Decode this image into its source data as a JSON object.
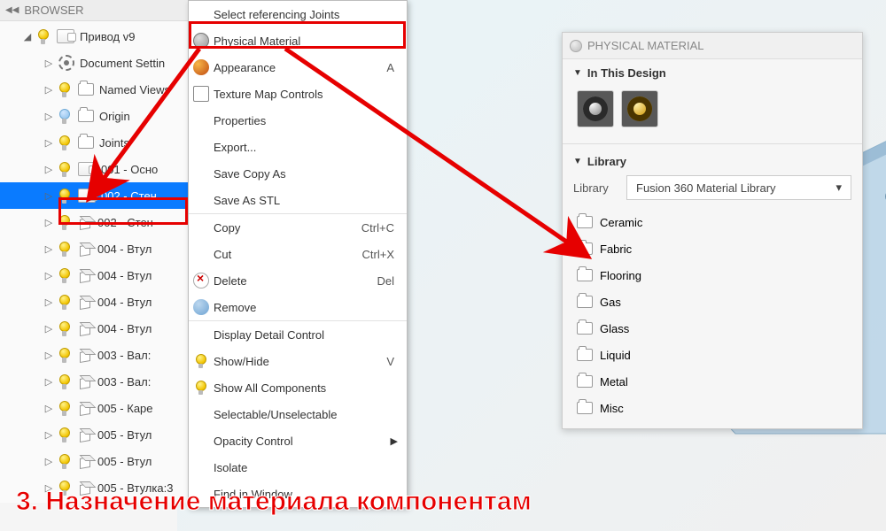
{
  "browser": {
    "title": "BROWSER",
    "root": "Привод v9",
    "items": [
      {
        "label": "Document Settin",
        "type": "gear"
      },
      {
        "label": "Named Views",
        "type": "folder"
      },
      {
        "label": "Origin",
        "type": "folder",
        "off": true
      },
      {
        "label": "Joints",
        "type": "folder"
      },
      {
        "label": "001 - Осно",
        "type": "comp"
      },
      {
        "label": "002 - Стен",
        "type": "comp",
        "sel": true
      },
      {
        "label": "002 - Стен",
        "type": "cube"
      },
      {
        "label": "004 - Втул",
        "type": "cube"
      },
      {
        "label": "004 - Втул",
        "type": "cube"
      },
      {
        "label": "004 - Втул",
        "type": "cube"
      },
      {
        "label": "004 - Втул",
        "type": "cube"
      },
      {
        "label": "003 - Вал:",
        "type": "cube"
      },
      {
        "label": "003 - Вал:",
        "type": "cube"
      },
      {
        "label": "005 - Каре",
        "type": "cube"
      },
      {
        "label": "005 - Втул",
        "type": "cube"
      },
      {
        "label": "005 - Втул",
        "type": "cube"
      },
      {
        "label": "005 - Втулка:3",
        "type": "cube"
      }
    ]
  },
  "menu": {
    "items": [
      {
        "label": "Select referencing Joints"
      },
      {
        "label": "Physical Material",
        "icon": "globe",
        "hl": true
      },
      {
        "label": "Appearance",
        "icon": "ball",
        "sc": "A"
      },
      {
        "label": "Texture Map Controls",
        "icon": "cubeb"
      },
      {
        "label": "Properties"
      },
      {
        "label": "Export..."
      },
      {
        "label": "Save Copy As"
      },
      {
        "label": "Save As STL"
      },
      {
        "sep": true
      },
      {
        "label": "Copy",
        "sc": "Ctrl+C"
      },
      {
        "label": "Cut",
        "sc": "Ctrl+X"
      },
      {
        "label": "Delete",
        "icon": "del",
        "sc": "Del"
      },
      {
        "label": "Remove",
        "icon": "rem"
      },
      {
        "sep": true
      },
      {
        "label": "Display Detail Control"
      },
      {
        "label": "Show/Hide",
        "icon": "bulb",
        "sc": "V"
      },
      {
        "label": "Show All Components",
        "icon": "bulb"
      },
      {
        "label": "Selectable/Unselectable"
      },
      {
        "label": "Opacity Control",
        "sub": true
      },
      {
        "label": "Isolate"
      },
      {
        "label": "Find in Window"
      }
    ]
  },
  "material": {
    "title": "PHYSICAL MATERIAL",
    "sec1": "In This Design",
    "sec2": "Library",
    "liblabel": "Library",
    "libselect": "Fusion 360 Material Library",
    "folders": [
      "Ceramic",
      "Fabric",
      "Flooring",
      "Gas",
      "Glass",
      "Liquid",
      "Metal",
      "Misc"
    ]
  },
  "caption": "3. Назначение материала компонентам"
}
